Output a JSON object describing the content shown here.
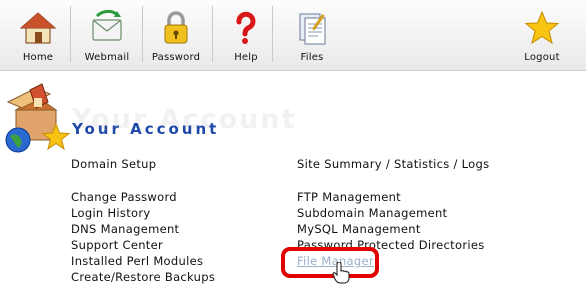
{
  "toolbar": {
    "items": [
      {
        "label": "Home",
        "icon": "home-icon"
      },
      {
        "label": "Webmail",
        "icon": "webmail-icon"
      },
      {
        "label": "Password",
        "icon": "padlock-icon"
      },
      {
        "label": "Help",
        "icon": "question-icon"
      },
      {
        "label": "Files",
        "icon": "files-icon"
      },
      {
        "label": "Logout",
        "icon": "star-icon"
      }
    ]
  },
  "header": {
    "title": "Your Account",
    "ghost_title": "Your Account",
    "logo_icon": "account-logo-icon"
  },
  "left_column": {
    "domain_setup": "Domain Setup",
    "links": [
      "Change Password",
      "Login History",
      "DNS Management",
      "Support Center",
      "Installed Perl Modules",
      "Create/Restore Backups"
    ]
  },
  "right_column": {
    "summary": "Site Summary / Statistics / Logs",
    "links": [
      "FTP Management",
      "Subdomain Management",
      "MySQL Management",
      "Password Protected Directories",
      "File Manager"
    ]
  },
  "colors": {
    "title": "#1f4aa8",
    "highlight": "#e00000",
    "active_link": "#9ab0cc"
  }
}
